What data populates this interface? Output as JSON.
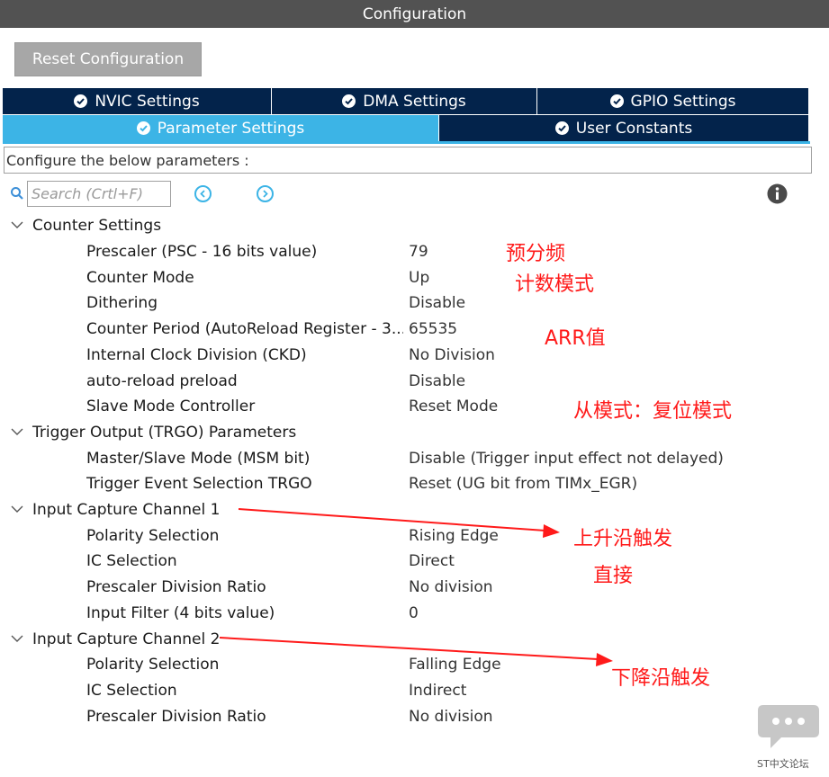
{
  "window": {
    "title": "Configuration"
  },
  "toolbar": {
    "reset_label": "Reset Configuration"
  },
  "tabs": [
    {
      "label": "NVIC Settings",
      "active": false
    },
    {
      "label": "DMA Settings",
      "active": false
    },
    {
      "label": "GPIO Settings",
      "active": false
    },
    {
      "label": "Parameter Settings",
      "active": true
    },
    {
      "label": "User Constants",
      "active": false
    }
  ],
  "config_hint": "Configure the below parameters :",
  "search": {
    "placeholder": "Search (Crtl+F)"
  },
  "groups": [
    {
      "title": "Counter Settings",
      "params": [
        {
          "name": "Prescaler (PSC - 16 bits value)",
          "value": "79"
        },
        {
          "name": "Counter Mode",
          "value": "Up"
        },
        {
          "name": "Dithering",
          "value": "Disable"
        },
        {
          "name": "Counter Period (AutoReload Register - 3...",
          "value": "65535"
        },
        {
          "name": "Internal Clock Division (CKD)",
          "value": "No Division"
        },
        {
          "name": "auto-reload preload",
          "value": "Disable"
        },
        {
          "name": "Slave Mode Controller",
          "value": "Reset Mode"
        }
      ]
    },
    {
      "title": "Trigger Output (TRGO) Parameters",
      "params": [
        {
          "name": "Master/Slave Mode (MSM bit)",
          "value": "Disable (Trigger input effect not delayed)"
        },
        {
          "name": "Trigger Event Selection TRGO",
          "value": "Reset (UG bit from TIMx_EGR)"
        }
      ]
    },
    {
      "title": "Input Capture Channel 1",
      "params": [
        {
          "name": "Polarity Selection",
          "value": "Rising Edge"
        },
        {
          "name": "IC Selection",
          "value": "Direct"
        },
        {
          "name": "Prescaler Division Ratio",
          "value": "No division"
        },
        {
          "name": "Input Filter (4 bits value)",
          "value": "0"
        }
      ]
    },
    {
      "title": "Input Capture Channel 2",
      "params": [
        {
          "name": "Polarity Selection",
          "value": "Falling Edge"
        },
        {
          "name": "IC Selection",
          "value": "Indirect"
        },
        {
          "name": "Prescaler Division Ratio",
          "value": "No division"
        }
      ]
    }
  ],
  "annotations": {
    "prescaler": "预分频",
    "counter_mode": "计数模式",
    "arr": "ARR值",
    "slave_mode": "从模式：复位模式",
    "rising": "上升沿触发",
    "direct": "直接",
    "falling": "下降沿触发"
  },
  "watermark": {
    "label": "ST中文论坛"
  },
  "colors": {
    "tab_dark": "#03234b",
    "tab_active": "#3cb4e6",
    "annotation": "#ff1a1a",
    "titlebar": "#525252"
  },
  "icons": [
    "check-circle-icon",
    "search-icon",
    "prev-arrow-icon",
    "next-arrow-icon",
    "info-icon",
    "chevron-down-icon",
    "chat-bubble-icon"
  ]
}
